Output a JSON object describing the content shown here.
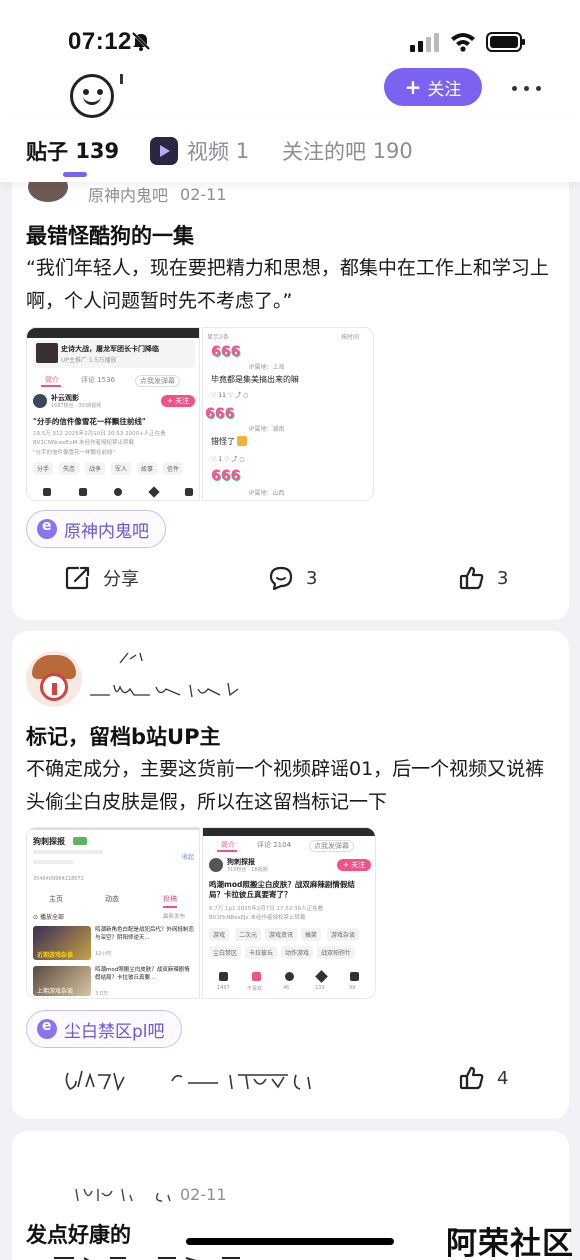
{
  "status_bar": {
    "time": "07:12"
  },
  "header": {
    "follow_label": "关注",
    "follow_plus": "+"
  },
  "tabs": [
    {
      "label": "贴子",
      "count": "139"
    },
    {
      "label": "视频",
      "count": "1"
    },
    {
      "label": "关注的吧",
      "count": "190"
    }
  ],
  "posts": [
    {
      "bar": "原神内鬼吧",
      "date": "02-11",
      "title": "最错怪酷狗的一集",
      "body": "“我们年轻人，现在要把精力和思想，都集中在工作上和学习上啊，个人问题暂时先不考虑了。”",
      "tag": "原神内鬼吧",
      "actions": {
        "share": "分享",
        "comments": "3",
        "likes": "3"
      },
      "left_img": {
        "ad_title": "史诗大战，屠龙军团长卡门降临",
        "ad_sub": "UP主推广·1.5万播放",
        "tab_intro": "简介",
        "tab_comments": "评论 1536",
        "tab_danmaku": "点我发弹幕",
        "user": "补云观影",
        "user_sub": "1687粉丝 · 3038视频",
        "follow": "+ 关注",
        "video_title": "\"分手的信件像雪花一样飘往前线\"",
        "stats": "19.5万  312  2025年2月10日 20:53  2000+人正在看",
        "bv": "BV1CNNceeEoM  未经作者授权禁止转载",
        "quote": "\"分手的信件像雪花一样飘往前线\"",
        "chips": [
          "分手",
          "失恋",
          "战争",
          "军人",
          "故事",
          "信件"
        ]
      },
      "right_img": {
        "header_left": "显示3条",
        "header_right": "按时间",
        "c1_loc": "IP属地：上海",
        "c1_text": "毕竟都是集美搞出来的嘛",
        "c1_likes": "11",
        "c2_loc": "IP属地：湖南",
        "c2_text": "错怪了",
        "c2_likes": "1",
        "c3_loc": "IP属地：山西",
        "sticker": "666"
      }
    },
    {
      "bar": "",
      "date": "",
      "title": "标记，留档b站UP主",
      "body": "不确定成分，主要这货前一个视频辟谣01，后一个视频又说裤头偷尘白皮肤是假，所以在这留档标记一下",
      "tag": "尘白禁区pl吧",
      "actions": {
        "likes": "4"
      },
      "left_img": {
        "name": "狗刺探报",
        "uid": "3546409964218071",
        "tabs": [
          "主页",
          "动态",
          "投稿"
        ],
        "play_all": "播放全部",
        "sort": "最新发布",
        "v1_title": "鸣潮新角色白配是战犯后代？外网抵制恋与深空？阴阳师逆天...",
        "v1_tag": "近期游戏杂谈",
        "v1_meta": "12小时",
        "v2_title": "鸣潮mod照搬尘白皮肤？战双麻辣剧情假结局？卡拉彼丘真要...",
        "v2_tag": "上期游戏杂谈",
        "v2_meta": "3.0万"
      },
      "right_img": {
        "tab_intro": "简介",
        "tab_comments": "评论 2104",
        "tab_danmaku": "点我发弹幕",
        "user": "狗刺探报",
        "user_sub": "310粉丝 · 18视频",
        "follow": "+ 关注",
        "video_title": "鸣潮mod照搬尘白皮肤？战双麻辣剧情假结局？卡拉彼丘真要寄了？",
        "stats": "6.7万  1p1  2025年2月7日 17:52  36人正在看",
        "bv": "BV1FkNBesEJx  未经作者授权禁止转载",
        "chips": [
          "游戏",
          "二次元",
          "游戏资讯",
          "搞笑",
          "游戏杂谈",
          "尘白禁区",
          "卡拉彼丘",
          "动作游戏",
          "战双帕弥什"
        ],
        "bottom": [
          "1497",
          "不喜欢",
          "46",
          "239",
          "99"
        ]
      }
    },
    {
      "bar": "",
      "date": "02-11",
      "title": "发点好康的",
      "body": ""
    }
  ],
  "watermark": "阿荣社区",
  "colors": {
    "accent": "#7b62f0",
    "pink": "#f0528a",
    "muted": "#8d8d94"
  }
}
